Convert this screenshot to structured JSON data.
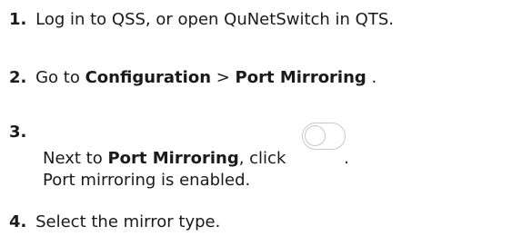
{
  "steps": [
    {
      "number": "1.",
      "text": "Log in to QSS, or open QuNetSwitch in QTS."
    },
    {
      "number": "2.",
      "prefix": "Go to ",
      "bold1": "Configuration",
      "separator": " > ",
      "bold2": "Port Mirroring",
      "suffix": " ."
    },
    {
      "number": "3.",
      "prefix": "Next to ",
      "bold": "Port Mirroring",
      "middle": ", click ",
      "suffix": ".",
      "result": "Port mirroring is enabled.",
      "toggle_icon": "toggle-off-icon",
      "toggle_state": "off"
    },
    {
      "number": "4.",
      "text": "Select the mirror type."
    }
  ]
}
